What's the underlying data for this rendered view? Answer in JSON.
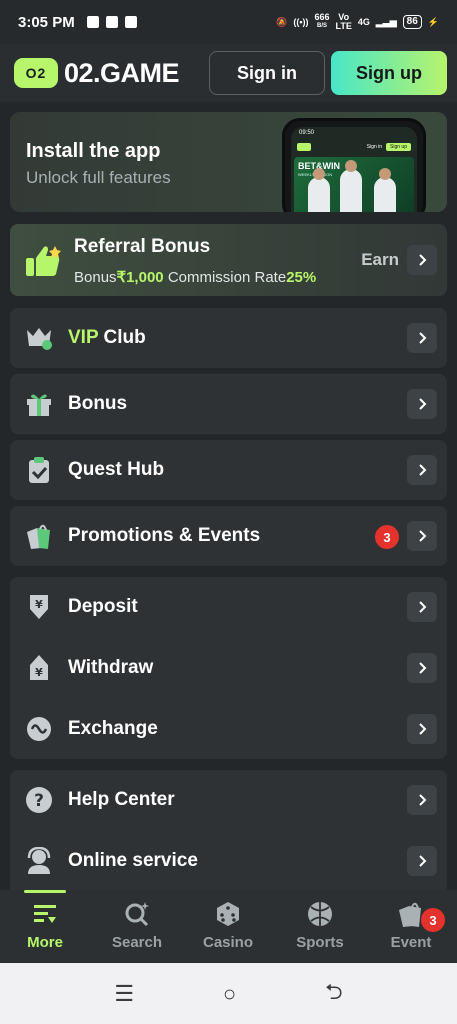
{
  "status_bar": {
    "time": "3:05 PM",
    "network_speed_value": "666",
    "network_speed_unit": "B/S",
    "volte_top": "Vo",
    "volte_bottom": "LTE",
    "network_type": "4G",
    "battery": "86"
  },
  "header": {
    "logo_text": "02.GAME",
    "logo_badge_text": "O2",
    "sign_in_label": "Sign in",
    "sign_up_label": "Sign up"
  },
  "install_banner": {
    "title": "Install the app",
    "subtitle": "Unlock full features",
    "phone_time": "09:50",
    "phone_sign_in": "Sign in",
    "phone_sign_up": "Sign up",
    "promo_title": "BET&WIN",
    "promo_subtitle": "WEEKLY SEASON"
  },
  "referral": {
    "title": "Referral Bonus",
    "bonus_label": "Bonus",
    "bonus_value": "₹1,000",
    "commission_label": "Commission Rate",
    "commission_value": "25%",
    "earn_label": "Earn"
  },
  "menu": {
    "vip_prefix": "VIP",
    "vip_suffix": " Club",
    "bonus": "Bonus",
    "quest_hub": "Quest Hub",
    "promotions": "Promotions & Events",
    "promotions_badge": "3",
    "deposit": "Deposit",
    "withdraw": "Withdraw",
    "exchange": "Exchange",
    "help_center": "Help Center",
    "online_service": "Online service"
  },
  "tabs": {
    "more": "More",
    "search": "Search",
    "casino": "Casino",
    "sports": "Sports",
    "event": "Event",
    "event_badge": "3"
  },
  "colors": {
    "accent": "#b7f56a",
    "background": "#23272a",
    "card": "#2e3235",
    "badge_red": "#e4322c"
  }
}
